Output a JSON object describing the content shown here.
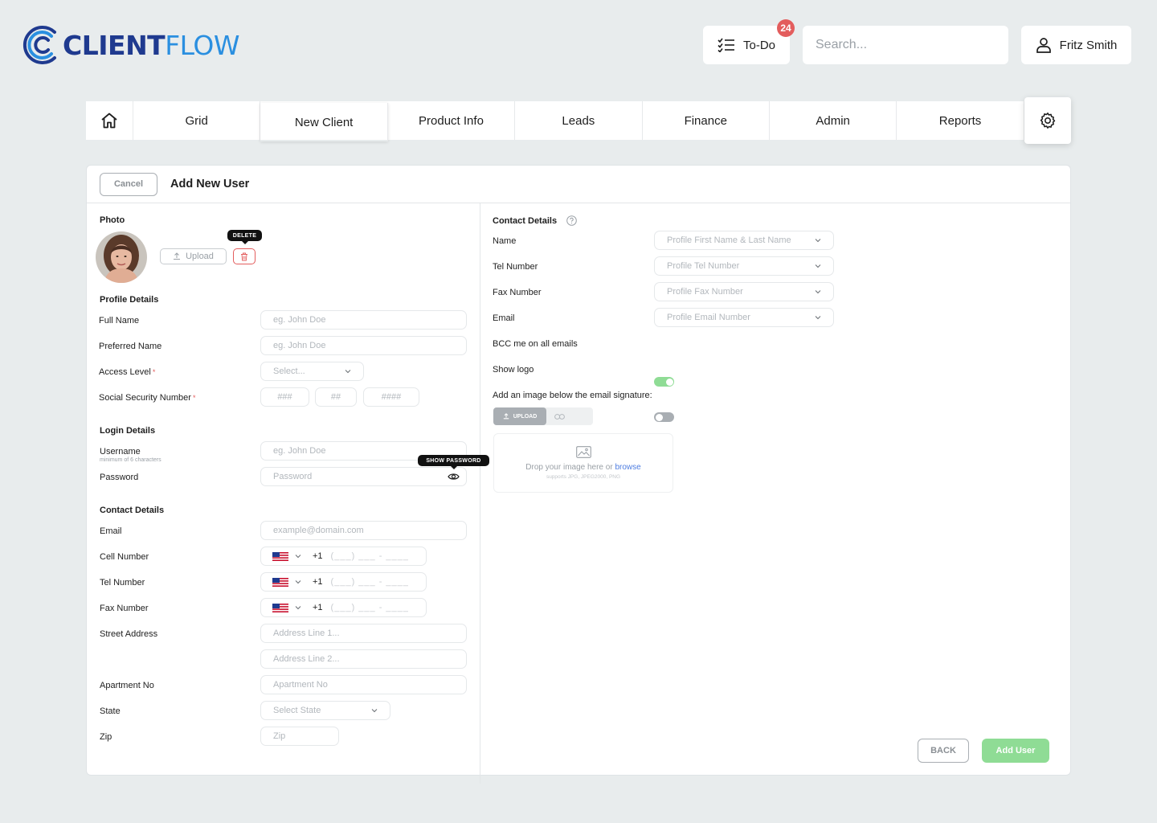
{
  "header": {
    "logo_bold": "CLIENT",
    "logo_light": "FLOW",
    "todo_label": "To-Do",
    "todo_count": "24",
    "search_placeholder": "Search...",
    "user_name": "Fritz Smith"
  },
  "nav": {
    "tabs": [
      {
        "label": "Grid"
      },
      {
        "label": "New Client"
      },
      {
        "label": "Product Info"
      },
      {
        "label": "Leads"
      },
      {
        "label": "Finance"
      },
      {
        "label": "Admin"
      },
      {
        "label": "Reports"
      }
    ],
    "active_tab": "New Client"
  },
  "panel": {
    "cancel_label": "Cancel",
    "title": "Add New User"
  },
  "left": {
    "photo": {
      "title": "Photo",
      "upload_label": "Upload",
      "delete_tooltip": "DELETE"
    },
    "profile": {
      "title": "Profile Details",
      "full_name_label": "Full Name",
      "full_name_placeholder": "eg. John Doe",
      "preferred_name_label": "Preferred Name",
      "preferred_name_placeholder": "eg. John Doe",
      "access_level_label": "Access Level",
      "access_level_placeholder": "Select...",
      "ssn_label": "Social Security Number",
      "ssn_part1": "###",
      "ssn_part2": "##",
      "ssn_part3": "####",
      "required_mark": "*"
    },
    "login": {
      "title": "Login Details",
      "username_label": "Username",
      "username_hint": "minimum of 6 characters",
      "username_placeholder": "eg. John Doe",
      "password_label": "Password",
      "password_placeholder": "Password",
      "show_password_tooltip": "SHOW PASSWORD"
    },
    "contact": {
      "title": "Contact Details",
      "email_label": "Email",
      "email_placeholder": "example@domain.com",
      "cell_label": "Cell Number",
      "tel_label": "Tel Number",
      "fax_label": "Fax Number",
      "country_code": "+1",
      "phone_mask": "(___) ___ - ____",
      "street_label": "Street Address",
      "address1_placeholder": "Address Line 1...",
      "address2_placeholder": "Address Line 2...",
      "apartment_label": "Apartment No",
      "apartment_placeholder": "Apartment No",
      "state_label": "State",
      "state_placeholder": "Select State",
      "zip_label": "Zip",
      "zip_placeholder": "Zip"
    }
  },
  "right": {
    "title": "Contact Details",
    "name_label": "Name",
    "name_placeholder": "Profile First Name & Last Name",
    "tel_label": "Tel Number",
    "tel_placeholder": "Profile Tel Number",
    "fax_label": "Fax Number",
    "fax_placeholder": "Profile Fax Number",
    "email_label": "Email",
    "email_placeholder": "Profile Email Number",
    "bcc_label": "BCC me on all emails",
    "bcc_on": true,
    "show_logo_label": "Show logo",
    "show_logo_on": false,
    "signature_label": "Add an image below the email signature:",
    "upload_tab": "UPLOAD",
    "drop_text": "Drop your image here or",
    "browse_text": "browse",
    "supports_text": "supports JPG, JPEG2000, PNG"
  },
  "footer": {
    "back_label": "BACK",
    "add_label": "Add User"
  },
  "colors": {
    "accent_green": "#8fdc95",
    "danger": "#e35d5d",
    "logo_dark": "#1f3a8f",
    "logo_light": "#2a8fe0"
  }
}
